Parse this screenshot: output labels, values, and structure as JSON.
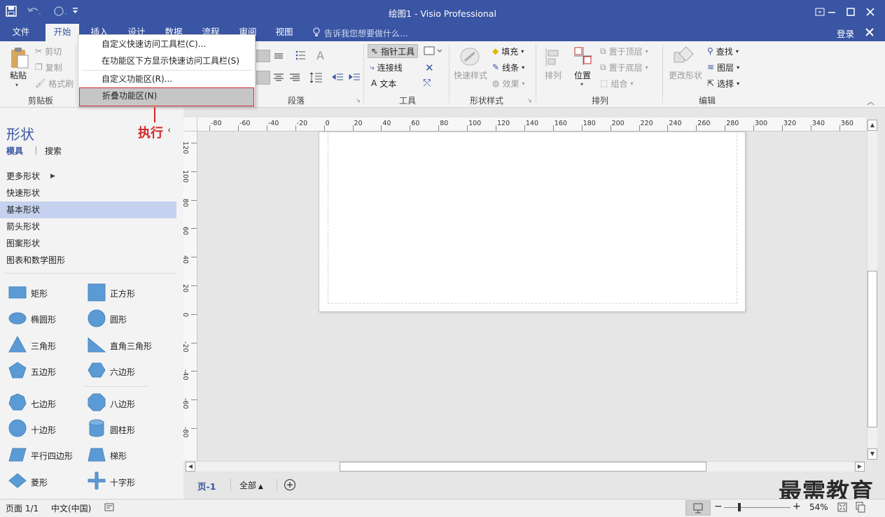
{
  "window": {
    "title": "绘图1 - Visio Professional",
    "minimize_icon": "minimize-icon",
    "maximize_icon": "maximize-icon",
    "close_icon": "close-icon"
  },
  "quick_access": {
    "save_icon": "save-icon",
    "undo_icon": "undo-icon",
    "redo_icon": "redo-icon",
    "customize_icon": "dropdown-arrow-icon"
  },
  "menu_tabs": [
    "文件",
    "开始",
    "插入",
    "设计",
    "数据",
    "流程",
    "审阅",
    "视图"
  ],
  "tell_me": "告诉我您想要做什么...",
  "signin": "登录",
  "ribbon": {
    "clipboard": {
      "paste": "粘贴",
      "cut": "剪切",
      "copy": "复制",
      "format_painter": "格式刷",
      "group": "剪贴板"
    },
    "paragraph": {
      "group": "段落"
    },
    "tools": {
      "pointer": "指针工具",
      "connector": "连接线",
      "text": "文本",
      "group": "工具"
    },
    "shape_styles": {
      "quick_styles": "快速样式",
      "fill": "填充",
      "line": "线条",
      "effects": "效果",
      "group": "形状样式"
    },
    "arrange": {
      "align": "排列",
      "position": "位置",
      "bring_front": "置于顶层",
      "send_back": "置于底层",
      "group_btn": "组合",
      "group": "排列"
    },
    "editing": {
      "change_shape": "更改形状",
      "find": "查找",
      "layers": "图层",
      "select": "选择",
      "group": "编辑"
    }
  },
  "context_menu": {
    "items": [
      "自定义快速访问工具栏(C)...",
      "在功能区下方显示快速访问工具栏(S)",
      "自定义功能区(R)...",
      "折叠功能区(N)"
    ],
    "highlighted": "折叠功能区(N)"
  },
  "annotation": {
    "text": "执行",
    "color": "#d0282a"
  },
  "shapes_pane": {
    "title": "形状",
    "tabs": [
      "模具",
      "搜索"
    ],
    "categories": [
      "更多形状",
      "快速形状",
      "基本形状",
      "箭头形状",
      "图案形状",
      "图表和数学图形"
    ],
    "selected_category": "基本形状",
    "shapes": [
      [
        "矩形",
        "正方形"
      ],
      [
        "椭圆形",
        "圆形"
      ],
      [
        "三角形",
        "直角三角形"
      ],
      [
        "五边形",
        "六边形"
      ],
      [
        "七边形",
        "八边形"
      ],
      [
        "十边形",
        "圆柱形"
      ],
      [
        "平行四边形",
        "梯形"
      ],
      [
        "菱形",
        "十字形"
      ]
    ],
    "shape_color": "#5b9bd5"
  },
  "rulers": {
    "horizontal": [
      "-80",
      "-60",
      "-40",
      "-20",
      "0",
      "20",
      "40",
      "60",
      "80",
      "100",
      "120",
      "140",
      "160",
      "180",
      "200",
      "220",
      "240",
      "260",
      "280",
      "300",
      "320",
      "340",
      "360"
    ],
    "vertical": [
      "120",
      "100",
      "80",
      "60",
      "40",
      "20",
      "0",
      "-20",
      "-40",
      "-60",
      "-80"
    ]
  },
  "page_tabs": {
    "current": "页-1",
    "all": "全部",
    "add_icon": "add-page-icon"
  },
  "status": {
    "page": "页面 1/1",
    "language": "中文(中国)",
    "zoom": "54%"
  },
  "watermark": "最需教育",
  "colors": {
    "accent": "#3955a3",
    "ribbon_bg": "#f3f3f3",
    "annotation": "#d0282a",
    "selected": "#c5d1ee"
  }
}
